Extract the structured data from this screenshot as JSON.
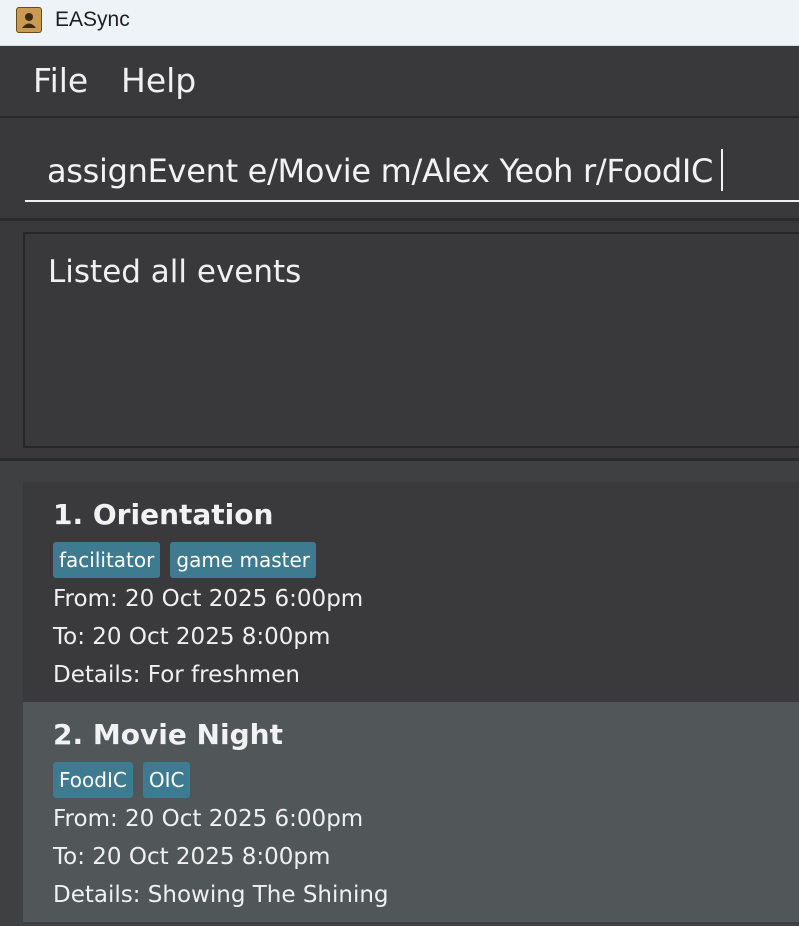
{
  "window": {
    "title": "EASync",
    "icon": "address-book-icon"
  },
  "menu": {
    "file": "File",
    "help": "Help"
  },
  "command": {
    "value": "assignEvent e/Movie m/Alex Yeoh r/FoodIC"
  },
  "result": {
    "message": "Listed all events"
  },
  "events": [
    {
      "title": "1. Orientation",
      "tags": [
        "facilitator",
        "game master"
      ],
      "from": "From: 20 Oct 2025 6:00pm",
      "to": "To: 20 Oct 2025 8:00pm",
      "details": "Details: For freshmen"
    },
    {
      "title": "2. Movie Night",
      "tags": [
        "FoodIC",
        "OIC"
      ],
      "from": "From: 20 Oct 2025 6:00pm",
      "to": "To: 20 Oct 2025 8:00pm",
      "details": "Details: Showing The Shining"
    }
  ],
  "colors": {
    "tag_background": "#3e7b91",
    "selected_card": "#515658",
    "panel": "#39393b"
  }
}
